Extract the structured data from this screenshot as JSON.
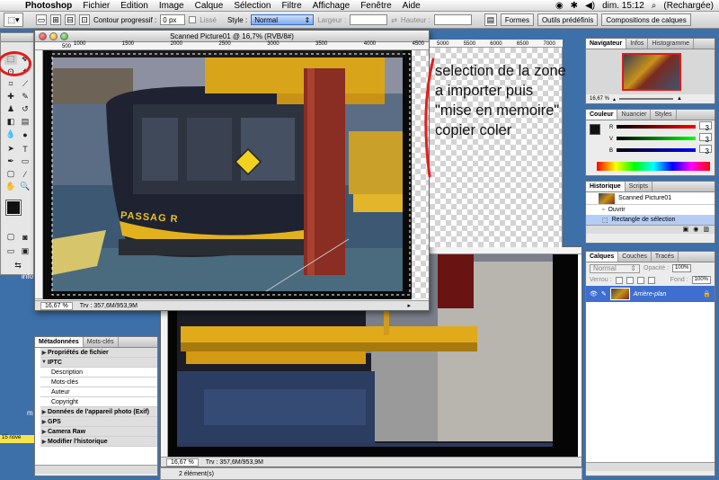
{
  "menubar": {
    "app": "Photoshop",
    "items": [
      "Fichier",
      "Edition",
      "Image",
      "Calque",
      "Sélection",
      "Filtre",
      "Affichage",
      "Fenêtre",
      "Aide"
    ],
    "clock": "dim. 15:12",
    "status": "(Rechargée)"
  },
  "options": {
    "feather_label": "Contour progressif :",
    "feather_value": "0 px",
    "antialias_label": "Lissé",
    "style_label": "Style :",
    "style_value": "Normal",
    "width_label": "Largeur :",
    "height_label": "Hauteur :",
    "tabs": [
      "Formes",
      "Outils prédéfinis",
      "Compositions de calques"
    ]
  },
  "doc1": {
    "title": "Scanned Picture01 @ 16,7% (RVB/8#)",
    "ruler": [
      "500",
      "1000",
      "1500",
      "2000",
      "2500",
      "3000",
      "3500",
      "4000",
      "4500",
      "5000",
      "5500",
      "6000",
      "6500",
      "7000"
    ],
    "zoom": "16,67 %",
    "info": "Trv : 357,6M/953,9M",
    "sign_text": "PASSAG R"
  },
  "doc2": {
    "zoom": "16,67 %",
    "info": "Trv : 357,6M/953,9M"
  },
  "finder_status": "2 élément(s)",
  "annotation": "selection de la zone a importer puis \"mise en memoire\" copier coler",
  "navigator": {
    "tabs": [
      "Navigateur",
      "Infos",
      "Histogramme"
    ],
    "zoom": "16,67 %"
  },
  "color": {
    "tabs": [
      "Couleur",
      "Nuancier",
      "Styles"
    ],
    "channels": [
      "R",
      "V",
      "B"
    ],
    "values": [
      "3",
      "3",
      "3"
    ]
  },
  "history": {
    "tabs": [
      "Historique",
      "Scripts"
    ],
    "snapshot": "Scanned Picture01",
    "steps": [
      "Ouvrir",
      "Rectangle de sélection"
    ]
  },
  "layers": {
    "tabs": [
      "Calques",
      "Couches",
      "Tracés"
    ],
    "mode": "Normal",
    "opacity_label": "Opacité :",
    "opacity_value": "100%",
    "lock_label": "Verrou :",
    "fill_label": "Fond :",
    "fill_value": "100%",
    "layer_name": "Arrière-plan"
  },
  "metadata": {
    "tabs": [
      "Métadonnées",
      "Mots-clés"
    ],
    "rows": [
      {
        "label": "Propriétés de fichier",
        "header": true
      },
      {
        "label": "IPTC",
        "header": true
      },
      {
        "label": "Description",
        "header": false
      },
      {
        "label": "Mots-clés",
        "header": false
      },
      {
        "label": "Auteur",
        "header": false
      },
      {
        "label": "Copyright",
        "header": false
      },
      {
        "label": "Données de l'appareil photo (Exif)",
        "header": true
      },
      {
        "label": "GPS",
        "header": true
      },
      {
        "label": "Camera Raw",
        "header": true
      },
      {
        "label": "Modifier l'historique",
        "header": true
      }
    ]
  },
  "desktop": {
    "label_info": "info",
    "label_m": "m",
    "date_badge": "15 nove"
  },
  "colors": {
    "annotation_red": "#e21d1d",
    "desktop_blue": "#3d6fa8",
    "selection_blue": "#3a6fc2"
  }
}
